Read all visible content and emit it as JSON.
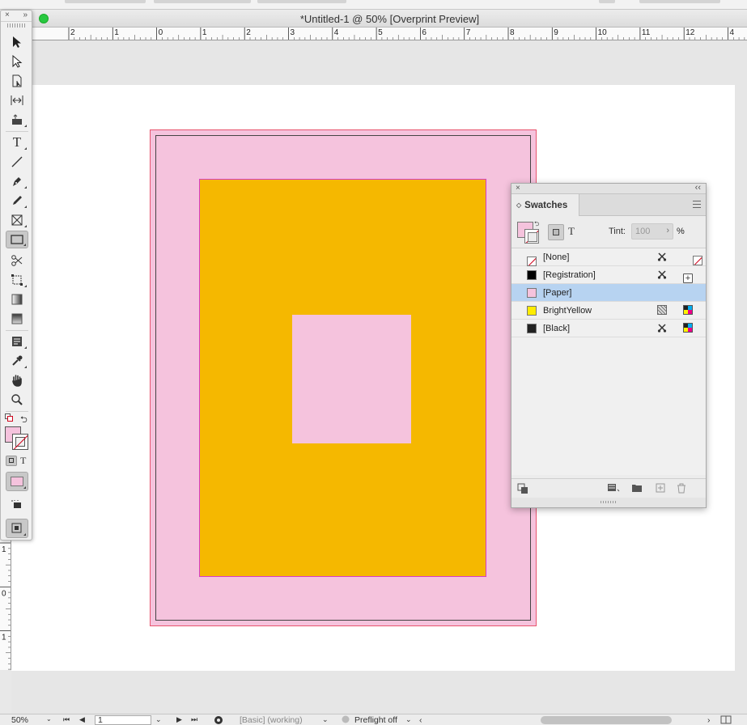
{
  "window": {
    "title": "*Untitled-1 @ 50% [Overprint Preview]"
  },
  "ruler": {
    "labels": [
      "2",
      "1",
      "0",
      "1",
      "2",
      "3",
      "4",
      "5",
      "6",
      "7",
      "8",
      "9",
      "10",
      "11",
      "12",
      "4"
    ]
  },
  "vruler": {
    "labels": [
      "1",
      "0",
      "1"
    ]
  },
  "tools": {
    "close": "×",
    "collapse": "»",
    "type_label": "T",
    "text_format_label": "T"
  },
  "swatches_panel": {
    "close": "×",
    "collapse": "‹‹",
    "tab_label": "Swatches",
    "tab_arrow": "◇",
    "format_t_label": "T",
    "tint_label": "Tint:",
    "tint_value": "100",
    "tint_chevron": "›",
    "tint_unit": "%",
    "swatches": [
      {
        "name": "[None]",
        "color": "none",
        "icon1": "scissor-lock-icon",
        "icon2": "none-icon",
        "selected": false
      },
      {
        "name": "[Registration]",
        "color": "#000000",
        "icon1": "scissor-lock-icon",
        "icon2": "registration-icon",
        "selected": false
      },
      {
        "name": "[Paper]",
        "color": "#f5c3dd",
        "icon1": "",
        "icon2": "",
        "selected": true
      },
      {
        "name": "BrightYellow",
        "color": "#ffec00",
        "icon1": "process-color-icon",
        "icon2": "cmyk-icon",
        "selected": false
      },
      {
        "name": "[Black]",
        "color": "#222222",
        "icon1": "scissor-lock-icon",
        "icon2": "cmyk-icon",
        "selected": false
      }
    ]
  },
  "status": {
    "zoom": "50%",
    "page": "1",
    "style": "[Basic] (working)",
    "preflight": "Preflight off"
  },
  "colors": {
    "paper": "#f5c3dd",
    "yellow": "#f5b800",
    "selection": "#b7d3f1"
  }
}
